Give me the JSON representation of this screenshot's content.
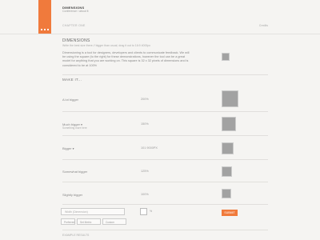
{
  "header": {
    "title": "DIMENSIONS",
    "subtitle": "Conference / about it",
    "section_label": "CHAPTER ONE",
    "section_right": "Credits"
  },
  "dimensions": {
    "heading": "DIMENSIONS",
    "subheading": "Write the best size there // bigger than usual, drag it out to 16:9 4000px",
    "description": "Dimensioning is a tool for designers, developers and clients to communicate feedback. We will be using the square (to the right) for these demonstrations, however the tool can be a great model for anything that you are working on. This square is 32 x 32 pixels of dimensions and is considered to be at 100%"
  },
  "make_heading": "MAKE IT...",
  "rows": [
    {
      "label": "A lot bigger",
      "sub": "",
      "value": "200%",
      "has_caret": false,
      "scale": 2.0
    },
    {
      "label": "Much bigger",
      "sub": "Something more here",
      "value": "150%",
      "has_caret": true,
      "scale": 1.6
    },
    {
      "label": "Bigger",
      "sub": "",
      "value": "101 9000PX",
      "has_caret": true,
      "scale": 1.4
    },
    {
      "label": "Somewhat bigger",
      "sub": "",
      "value": "125%",
      "has_caret": false,
      "scale": 1.2
    },
    {
      "label": "Slightly bigger",
      "sub": "",
      "value": "100%",
      "has_caret": false,
      "scale": 1.0
    }
  ],
  "form": {
    "input_placeholder": "Width (Dimension)",
    "select_a": "Preferred",
    "select_b": "Set Metric",
    "select_c": "Custom",
    "checkbox_label": "%",
    "submit_label": "SUBMIT"
  },
  "footer": "EXAMPLE RESULTS"
}
